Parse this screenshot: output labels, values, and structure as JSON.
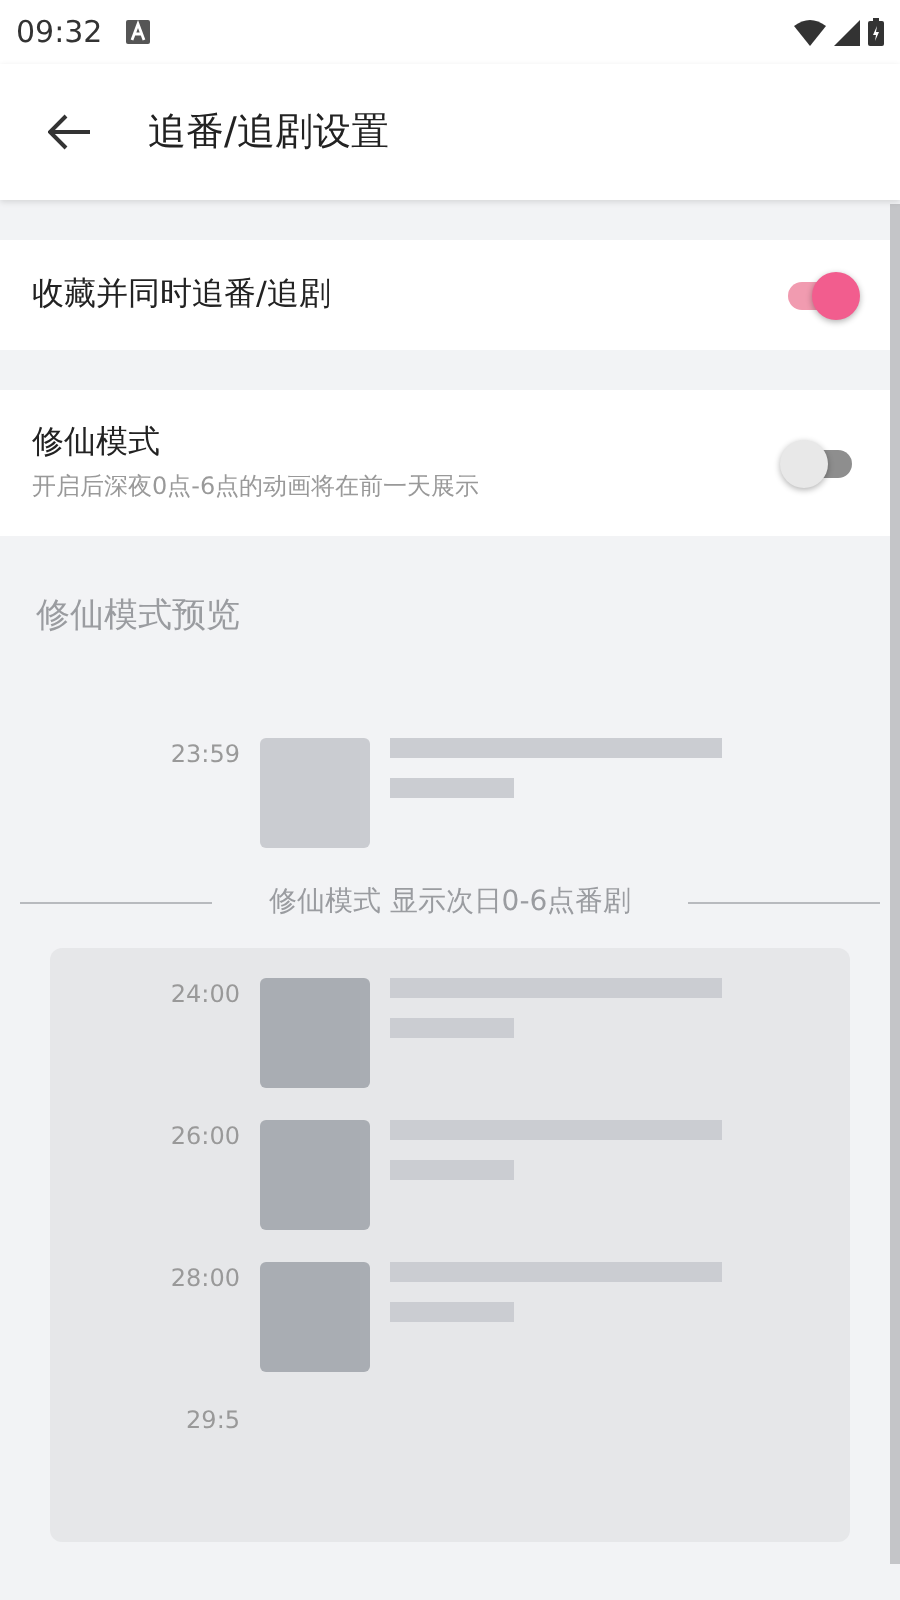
{
  "status_bar": {
    "time": "09:32"
  },
  "app_bar": {
    "title": "追番/追剧设置"
  },
  "settings": [
    {
      "title": "收藏并同时追番/追剧",
      "on": true
    },
    {
      "title": "修仙模式",
      "subtitle": "开启后深夜0点-6点的动画将在前一天展示",
      "on": false
    }
  ],
  "preview": {
    "title": "修仙模式预览",
    "before": [
      {
        "time": "23:59",
        "kind": "item"
      }
    ],
    "divider_label": "修仙模式 显示次日0-6点番剧",
    "next_day": [
      {
        "time": "24:00",
        "kind": "item"
      },
      {
        "time": "26:00",
        "kind": "item"
      },
      {
        "time": "28:00",
        "kind": "item"
      },
      {
        "time": "29:5",
        "kind": "time_only"
      }
    ]
  }
}
